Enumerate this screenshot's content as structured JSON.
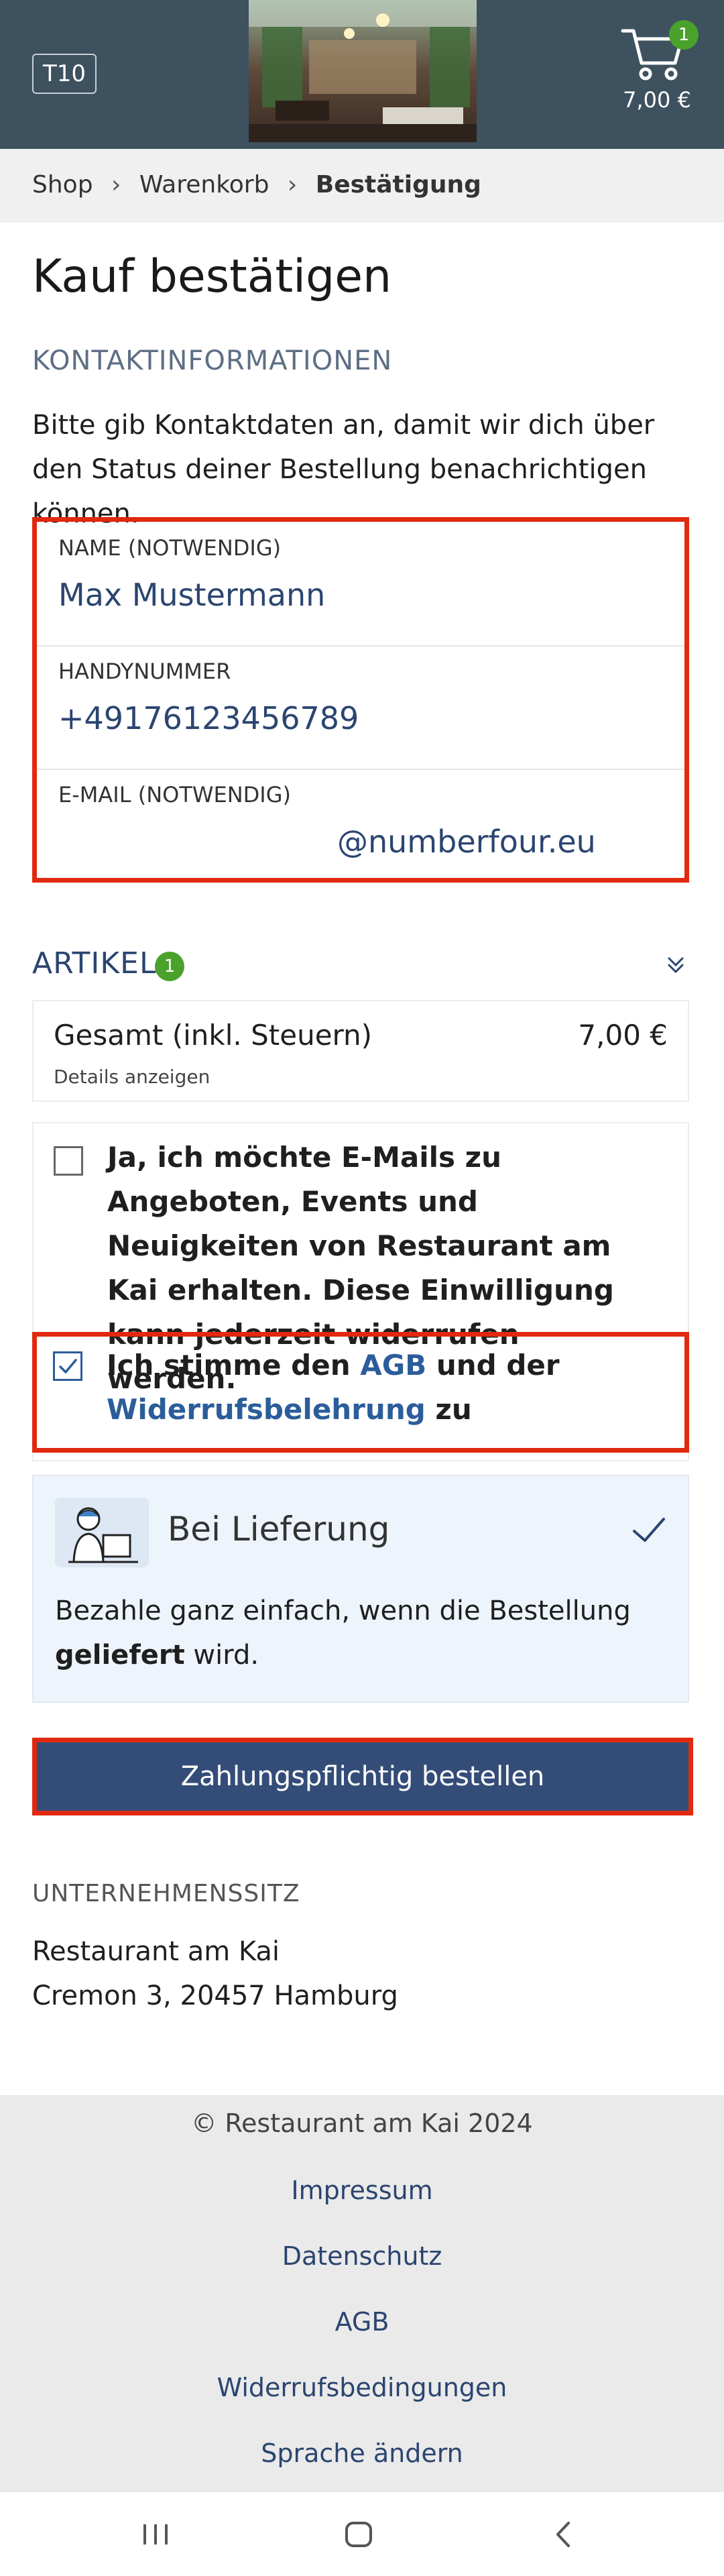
{
  "header": {
    "table_badge": "T10",
    "cart": {
      "count": "1",
      "total": "7,00 €"
    }
  },
  "breadcrumb": {
    "items": [
      "Shop",
      "Warenkorb",
      "Bestätigung"
    ],
    "separator": "›"
  },
  "page_title": "Kauf bestätigen",
  "contact": {
    "section_title": "KONTAKTINFORMATIONEN",
    "intro": "Bitte gib Kontaktdaten an, damit wir dich über den Status deiner Bestellung benachrichtigen können.",
    "fields": [
      {
        "label": "NAME (NOTWENDIG)",
        "value": "Max Mustermann"
      },
      {
        "label": "HANDYNUMMER",
        "value": "+49176123456789"
      },
      {
        "label": "E-MAIL (NOTWENDIG)",
        "value": "@numberfour.eu"
      }
    ]
  },
  "articles": {
    "title": "ARTIKEL",
    "count": "1",
    "total_label": "Gesamt (inkl. Steuern)",
    "total_value": "7,00 €",
    "details_link": "Details anzeigen"
  },
  "consent": {
    "newsletter_text": "Ja, ich möchte E-Mails zu Angeboten, Events und Neuigkeiten von Restaurant am Kai erhalten. Diese Einwilligung kann jederzeit widerrufen werden.",
    "newsletter_checked": false,
    "agb_prefix": "Ich stimme den ",
    "agb_link": "AGB",
    "agb_middle": " und der",
    "widerruf_link": "Widerrufsbelehrung",
    "agb_suffix": " zu",
    "agb_checked": true
  },
  "payment": {
    "title": "Bei Lieferung",
    "desc_prefix": "Bezahle ganz einfach, wenn die Bestellung ",
    "desc_bold": "geliefert",
    "desc_suffix": " wird."
  },
  "order_button": "Zahlungspflichtig bestellen",
  "company": {
    "title": "UNTERNEHMENSSITZ",
    "name": "Restaurant am Kai",
    "address": "Cremon 3, 20457 Hamburg"
  },
  "footer": {
    "copyright": "© Restaurant am Kai 2024",
    "links": [
      "Impressum",
      "Datenschutz",
      "AGB",
      "Widerrufsbedingungen",
      "Sprache ändern"
    ]
  },
  "colors": {
    "header_bg": "#3e515e",
    "accent_blue": "#2b4570",
    "button_bg": "#344d78",
    "highlight_red": "#e0290f",
    "badge_green": "#4aa12b"
  }
}
